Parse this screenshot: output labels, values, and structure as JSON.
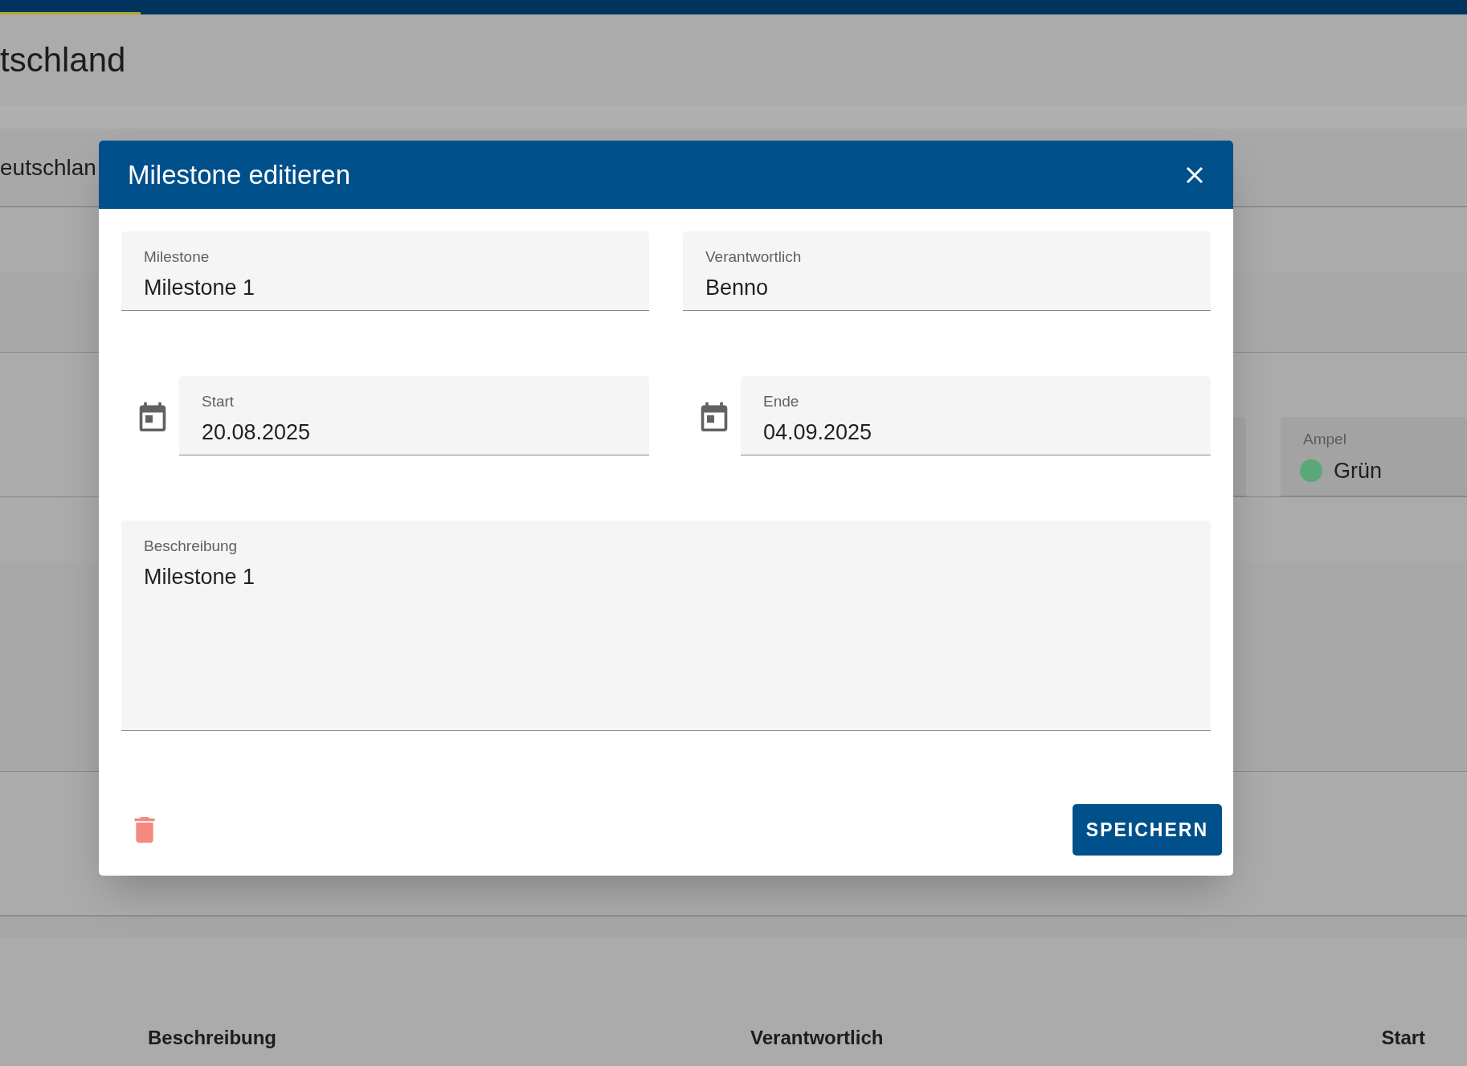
{
  "background": {
    "heading": "tschland",
    "row_label": "eutschlan",
    "ampel": {
      "label": "Ampel",
      "value": "Grün",
      "color": "#5aa878"
    },
    "table": {
      "columns": [
        "Beschreibung",
        "Verantwortlich",
        "Start"
      ]
    }
  },
  "dialog": {
    "title": "Milestone editieren",
    "fields": [
      {
        "kind": "text",
        "label": "Milestone",
        "value": "Milestone 1"
      },
      {
        "kind": "text",
        "label": "Verantwortlich",
        "value": "Benno"
      },
      {
        "kind": "date",
        "label": "Start",
        "value": "20.08.2025"
      },
      {
        "kind": "date",
        "label": "Ende",
        "value": "04.09.2025"
      },
      {
        "kind": "textarea",
        "label": "Beschreibung",
        "value": "Milestone 1"
      }
    ],
    "save_button": "SPEICHERN"
  }
}
